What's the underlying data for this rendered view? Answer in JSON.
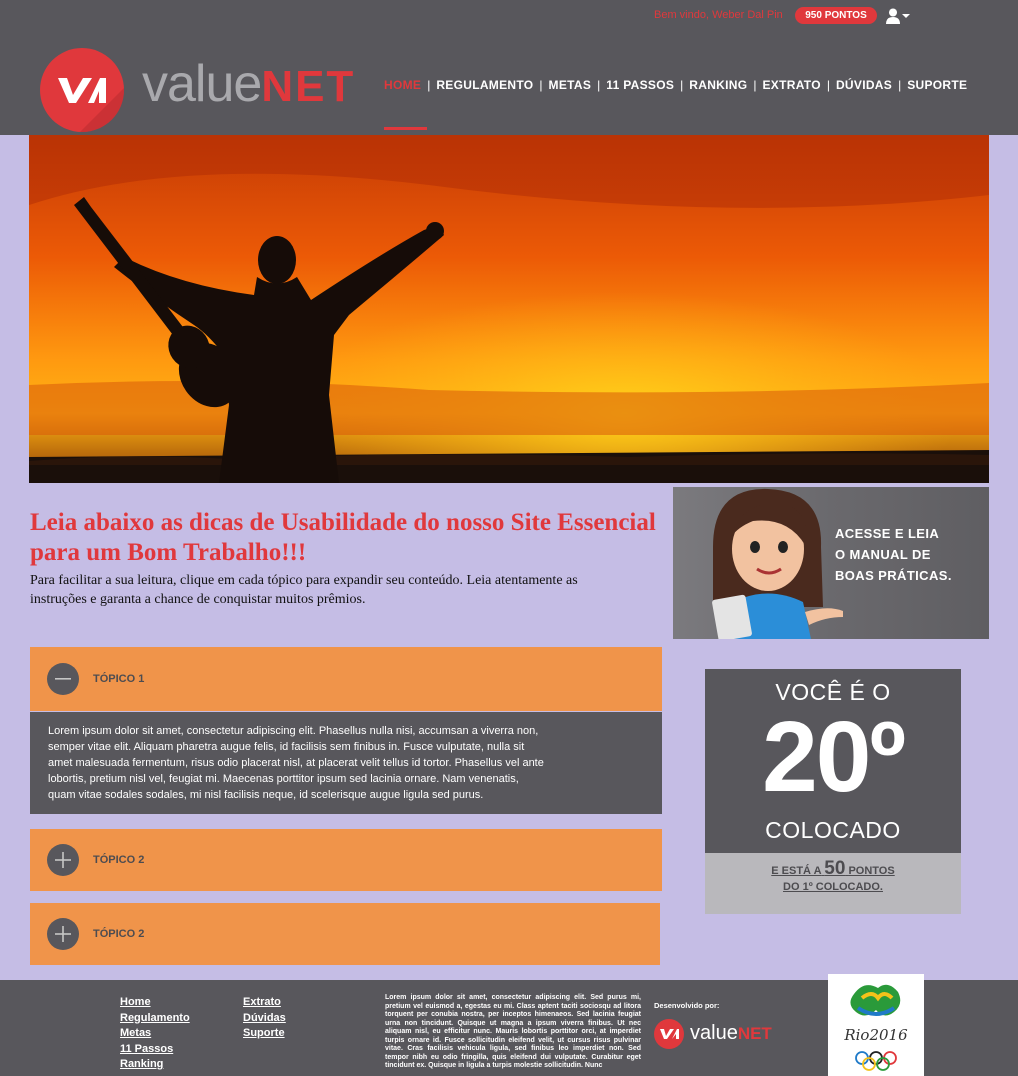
{
  "header": {
    "welcome": "Bem vindo, Weber Dal Pin",
    "points": "950 PONTOS",
    "logo_value": "value",
    "logo_net": "NET"
  },
  "nav": {
    "items": [
      {
        "label": "HOME",
        "active": true
      },
      {
        "label": "REGULAMENTO"
      },
      {
        "label": "METAS"
      },
      {
        "label": "11 PASSOS"
      },
      {
        "label": "RANKING"
      },
      {
        "label": "EXTRATO"
      },
      {
        "label": "DÚVIDAS"
      },
      {
        "label": "SUPORTE"
      }
    ]
  },
  "intro": {
    "title": "Leia abaixo as dicas de Usabilidade do nosso Site Essencial para um Bom Trabalho!!!",
    "text": "Para facilitar a sua leitura, clique em cada tópico para expandir seu conteúdo. Leia atentamente as instruções e garanta a chance de conquistar muitos prêmios."
  },
  "manual": {
    "line1": "ACESSE E LEIA",
    "line2": "O MANUAL DE",
    "line3": "BOAS PRÁTICAS."
  },
  "accordion": {
    "topic1": "TÓPICO 1",
    "topic2": "TÓPICO 2",
    "topic3": "TÓPICO 2",
    "body": "Lorem ipsum dolor sit amet, consectetur adipiscing elit. Phasellus nulla nisi, accumsan a viverra non, semper vitae elit. Aliquam pharetra augue felis, id facilisis sem finibus in. Fusce vulputate, nulla sit amet malesuada fermentum, risus odio placerat nisl, at placerat velit tellus id tortor. Phasellus vel ante lobortis, pretium nisl vel, feugiat mi. Maecenas porttitor ipsum sed lacinia ornare. Nam venenatis, quam vitae sodales sodales, mi nisl facilisis neque, id scelerisque augue ligula sed purus."
  },
  "rank": {
    "top": "VOCÊ É O",
    "position": "20º",
    "bottom": "COLOCADO",
    "foot_pre": "E ESTÁ A",
    "foot_points": "50",
    "foot_post": "PONTOS",
    "foot_line2": "DO 1º COLOCADO."
  },
  "footer": {
    "col1": [
      "Home",
      "Regulamento",
      "Metas",
      "11 Passos",
      "Ranking"
    ],
    "col2": [
      "Extrato",
      "Dúvidas",
      "Suporte"
    ],
    "lorem": "Lorem ipsum dolor sit amet, consectetur adipiscing elit. Sed purus mi, pretium vel euismod a, egestas eu mi. Class aptent taciti sociosqu ad litora torquent per conubia nostra, per inceptos himenaeos. Sed lacinia feugiat urna non tincidunt. Quisque ut magna a ipsum viverra finibus. Ut nec aliquam nisl, eu efficitur nunc. Mauris lobortis porttitor orci, at imperdiet turpis ornare id. Fusce sollicitudin eleifend velit, ut cursus risus pulvinar vitae. Cras facilisis vehicula ligula, sed finibus leo imperdiet non. Sed tempor nibh eu odio fringilla, quis eleifend dui vulputate. Curabitur eget tincidunt ex. Quisque in ligula a turpis molestie sollicitudin. Nunc",
    "dev_label": "Desenvolvido por:",
    "dev_value": "value",
    "dev_net": "NET"
  }
}
